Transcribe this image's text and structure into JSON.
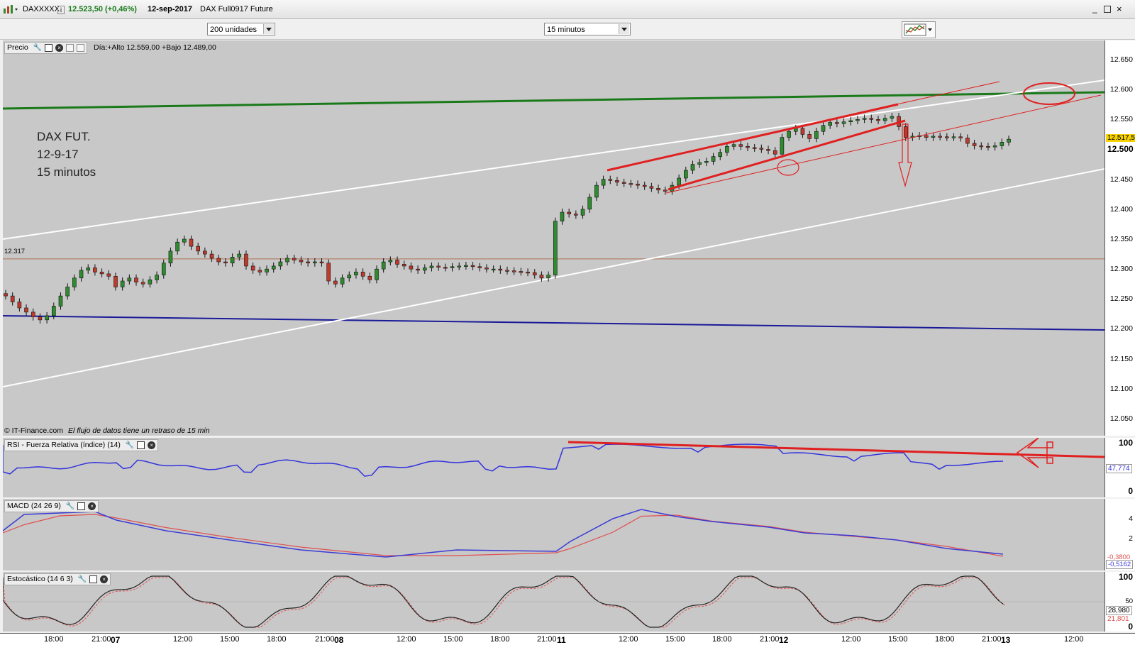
{
  "window": {
    "symbol": "DAXXXXX",
    "info": "i",
    "last": "12.523,50 (+0,46%)",
    "date": "12-sep-2017",
    "name": "DAX Full0917 Future"
  },
  "toolbar": {
    "units": "200 unidades",
    "interval": "15 minutos"
  },
  "price_panel": {
    "title": "Precio",
    "day_info": "Día:+Alto 12.559,00 +Bajo 12.489,00",
    "ref_line": "12.317",
    "copyright": "© IT-Finance.com",
    "delay_note": "El flujo de datos tiene un retraso de 15 min",
    "badge_last": "12.517,5",
    "badge_bold": "12.500",
    "annotation": [
      "DAX FUT.",
      "12-9-17",
      "15 minutos"
    ],
    "yticks": [
      "12.650",
      "12.600",
      "12.550",
      "12.450",
      "12.400",
      "12.350",
      "12.300",
      "12.250",
      "12.200",
      "12.150",
      "12.100",
      "12.050"
    ]
  },
  "rsi_panel": {
    "title": "RSI - Fuerza Relativa (índice) (14)",
    "yticks": [
      "100",
      "0"
    ],
    "value": "47,774"
  },
  "macd_panel": {
    "title": "MACD (24 26 9)",
    "yticks": [
      "4",
      "2"
    ],
    "value_a": "-0,3800",
    "value_b": "-0,5162"
  },
  "stoch_panel": {
    "title": "Estocástico (14 6 3)",
    "yticks": [
      "100",
      "50",
      "0"
    ],
    "value_a": "28,980",
    "value_b": "21,801"
  },
  "time_axis": [
    "18:00",
    "21:00",
    "07",
    "12:00",
    "15:00",
    "18:00",
    "21:00",
    "08",
    "12:00",
    "15:00",
    "18:00",
    "21:00",
    "11",
    "12:00",
    "15:00",
    "18:00",
    "21:00",
    "12",
    "12:00",
    "15:00",
    "18:00",
    "21:00",
    "13",
    "12:00"
  ],
  "colors": {
    "bg": "#c8c8c8",
    "up": "#2e8b2e",
    "down": "#c0392b",
    "green_line": "#1a7a1a",
    "blue_line": "#1a1a99",
    "red_line": "#e02020",
    "rsi": "#3333dd",
    "macd": "#3b3bd6",
    "signal": "#e05050"
  },
  "chart_data": {
    "type": "candlestick",
    "title": "DAX Full0917 Future",
    "interval": "15 minutos",
    "ylim": [
      12030,
      12670
    ],
    "closes": [
      12255,
      12245,
      12235,
      12228,
      12220,
      12215,
      12222,
      12238,
      12255,
      12270,
      12285,
      12298,
      12302,
      12295,
      12292,
      12288,
      12270,
      12280,
      12285,
      12278,
      12275,
      12282,
      12290,
      12310,
      12330,
      12345,
      12350,
      12338,
      12330,
      12325,
      12318,
      12312,
      12310,
      12320,
      12325,
      12305,
      12298,
      12295,
      12300,
      12305,
      12312,
      12318,
      12315,
      12312,
      12310,
      12312,
      12310,
      12280,
      12275,
      12285,
      12290,
      12295,
      12288,
      12282,
      12300,
      12312,
      12315,
      12308,
      12305,
      12300,
      12298,
      12302,
      12305,
      12303,
      12302,
      12304,
      12305,
      12306,
      12304,
      12302,
      12300,
      12300,
      12298,
      12297,
      12296,
      12295,
      12294,
      12290,
      12285,
      12290,
      12380,
      12395,
      12392,
      12390,
      12400,
      12420,
      12440,
      12450,
      12448,
      12445,
      12443,
      12442,
      12440,
      12438,
      12435,
      12432,
      12430,
      12440,
      12452,
      12465,
      12475,
      12478,
      12480,
      12488,
      12495,
      12505,
      12508,
      12505,
      12503,
      12502,
      12500,
      12498,
      12492,
      12520,
      12530,
      12535,
      12525,
      12518,
      12530,
      12540,
      12545,
      12543,
      12546,
      12548,
      12550,
      12552,
      12550,
      12548,
      12552,
      12555,
      12538,
      12520,
      12522,
      12523,
      12520,
      12522,
      12521,
      12520,
      12521,
      12519,
      12510,
      12506,
      12505,
      12504,
      12506,
      12512,
      12517
    ]
  }
}
